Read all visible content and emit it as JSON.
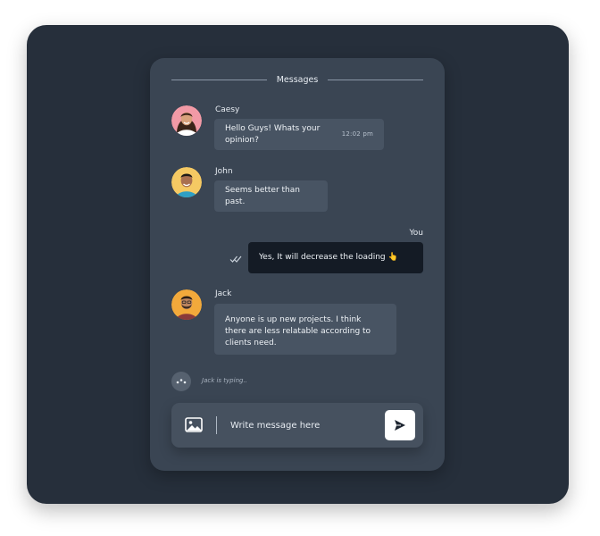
{
  "header": {
    "title": "Messages"
  },
  "messages": [
    {
      "sender": "Caesy",
      "text": "Hello Guys! Whats your opinion?",
      "time": "12:02 pm",
      "avatar": "avatar-caesy"
    },
    {
      "sender": "John",
      "text": "Seems better than past.",
      "avatar": "avatar-john"
    },
    {
      "sender": "You",
      "text": "Yes, It will decrease the loading 👆",
      "status": "double-check-icon"
    },
    {
      "sender": "Jack",
      "text": "Anyone is up new projects. I think\nthere are less relatable according to\nclients need.",
      "avatar": "avatar-jack"
    }
  ],
  "typing": {
    "text": "Jack is typing.."
  },
  "composer": {
    "placeholder": "Write message here",
    "attach_icon": "image-icon",
    "send_icon": "send-icon"
  },
  "colors": {
    "page_bg": "#262f3b",
    "card_bg": "#3a4553",
    "bubble_bg": "#485463",
    "own_bubble_bg": "#141b25",
    "send_button_bg": "#ffffff"
  }
}
